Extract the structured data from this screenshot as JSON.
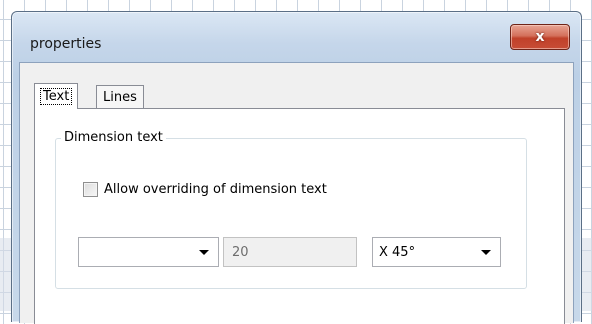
{
  "window": {
    "title": "properties",
    "close_glyph": "x"
  },
  "tabs": [
    {
      "label": "Text",
      "active": true
    },
    {
      "label": "Lines",
      "active": false
    }
  ],
  "group": {
    "legend": "Dimension text",
    "checkbox": {
      "label": "Allow overriding of dimension text",
      "checked": false
    }
  },
  "controls": {
    "left_select": {
      "value": ""
    },
    "size_field": {
      "value": "20",
      "disabled": true
    },
    "angle_select": {
      "value": "X 45°"
    }
  },
  "icons": {
    "close": "close-icon",
    "dropdown": "chevron-down-icon"
  },
  "colors": {
    "close_button": "#c74c35",
    "title_bar": "#c5d6ea",
    "panel_background": "#ffffff",
    "grid_lines": "#c9d3df"
  }
}
